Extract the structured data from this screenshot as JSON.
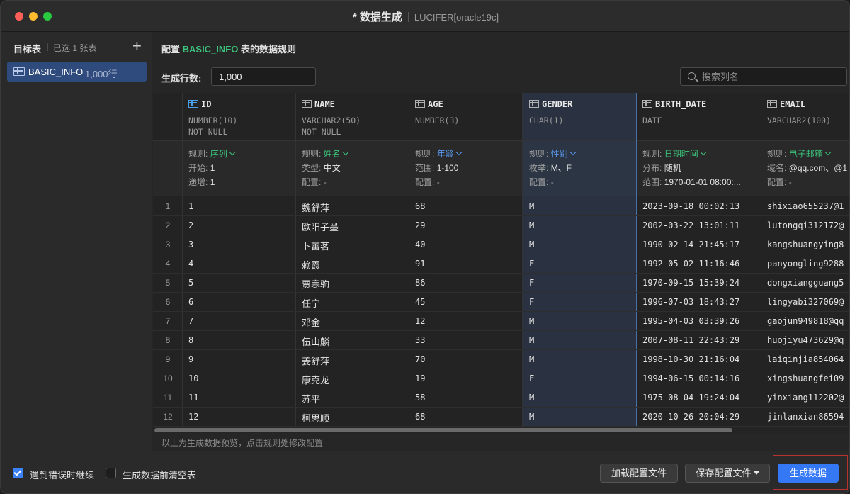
{
  "window": {
    "title": "* 数据生成",
    "connection": "LUCIFER[oracle19c]"
  },
  "sidebar": {
    "title": "目标表",
    "selected_count": "已选 1 张表",
    "add_label": "+",
    "items": [
      {
        "name": "BASIC_INFO",
        "rows": "1,000行"
      }
    ]
  },
  "config": {
    "prefix": "配置 ",
    "table_name": "BASIC_INFO",
    "suffix": " 表的数据规则",
    "rows_label": "生成行数:",
    "rows_value": "1,000",
    "search_placeholder": "搜索列名"
  },
  "columns": [
    {
      "name": "ID",
      "type": "NUMBER(10)",
      "null": "NOT NULL",
      "key": true,
      "rule_label": "规则:",
      "rule": "序列",
      "rule_color": "green",
      "l2_label": "开始:",
      "l2": "1",
      "l3_label": "递增:",
      "l3": "1"
    },
    {
      "name": "NAME",
      "type": "VARCHAR2(50)",
      "null": "NOT NULL",
      "key": false,
      "rule_label": "规则:",
      "rule": "姓名",
      "rule_color": "green",
      "l2_label": "类型:",
      "l2": "中文",
      "l3_label": "配置:",
      "l3": "-"
    },
    {
      "name": "AGE",
      "type": "NUMBER(3)",
      "null": "",
      "key": false,
      "rule_label": "规则:",
      "rule": "年龄",
      "rule_color": "blue",
      "l2_label": "范围:",
      "l2": "1-100",
      "l3_label": "配置:",
      "l3": "-"
    },
    {
      "name": "GENDER",
      "type": "CHAR(1)",
      "null": "",
      "key": false,
      "rule_label": "规则:",
      "rule": "性别",
      "rule_color": "blue",
      "l2_label": "枚举:",
      "l2": "M、F",
      "l3_label": "配置:",
      "l3": "-"
    },
    {
      "name": "BIRTH_DATE",
      "type": "DATE",
      "null": "",
      "key": false,
      "rule_label": "规则:",
      "rule": "日期时间",
      "rule_color": "green",
      "l2_label": "分布:",
      "l2": "随机",
      "l3_label": "范围:",
      "l3": "1970-01-01 08:00:..."
    },
    {
      "name": "EMAIL",
      "type": "VARCHAR2(100)",
      "null": "",
      "key": false,
      "rule_label": "规则:",
      "rule": "电子邮箱",
      "rule_color": "green",
      "l2_label": "域名:",
      "l2": "@qq.com、@1",
      "l3_label": "配置:",
      "l3": "-"
    }
  ],
  "rows": [
    {
      "n": "1",
      "id": "1",
      "name": "魏舒萍",
      "age": "68",
      "gender": "M",
      "birth": "2023-09-18 00:02:13",
      "email": "shixiao655237@1"
    },
    {
      "n": "2",
      "id": "2",
      "name": "欧阳子墨",
      "age": "29",
      "gender": "M",
      "birth": "2002-03-22 13:01:11",
      "email": "lutongqi312172@"
    },
    {
      "n": "3",
      "id": "3",
      "name": "卜蕾茗",
      "age": "40",
      "gender": "M",
      "birth": "1990-02-14 21:45:17",
      "email": "kangshuangying8"
    },
    {
      "n": "4",
      "id": "4",
      "name": "赖霞",
      "age": "91",
      "gender": "F",
      "birth": "1992-05-02 11:16:46",
      "email": "panyongling9288"
    },
    {
      "n": "5",
      "id": "5",
      "name": "贾寒驹",
      "age": "86",
      "gender": "F",
      "birth": "1970-09-15 15:39:24",
      "email": "dongxiangguang5"
    },
    {
      "n": "6",
      "id": "6",
      "name": "任宁",
      "age": "45",
      "gender": "F",
      "birth": "1996-07-03 18:43:27",
      "email": "lingyabi327069@"
    },
    {
      "n": "7",
      "id": "7",
      "name": "邓金",
      "age": "12",
      "gender": "M",
      "birth": "1995-04-03 03:39:26",
      "email": "gaojun949818@qq"
    },
    {
      "n": "8",
      "id": "8",
      "name": "伍山麟",
      "age": "33",
      "gender": "M",
      "birth": "2007-08-11 22:43:29",
      "email": "huojiyu473629@q"
    },
    {
      "n": "9",
      "id": "9",
      "name": "姜舒萍",
      "age": "70",
      "gender": "M",
      "birth": "1998-10-30 21:16:04",
      "email": "laiqinjia854064"
    },
    {
      "n": "10",
      "id": "10",
      "name": "康克龙",
      "age": "19",
      "gender": "F",
      "birth": "1994-06-15 00:14:16",
      "email": "xingshuangfei09"
    },
    {
      "n": "11",
      "id": "11",
      "name": "苏平",
      "age": "58",
      "gender": "M",
      "birth": "1975-08-04 19:24:04",
      "email": "yinxiang112202@"
    },
    {
      "n": "12",
      "id": "12",
      "name": "柯思顺",
      "age": "68",
      "gender": "M",
      "birth": "2020-10-26 20:04:29",
      "email": "jinlanxian86594"
    }
  ],
  "preview_note": "以上为生成数据预览，点击规则处修改配置",
  "footer": {
    "continue_on_error": "遇到错误时继续",
    "continue_on_error_checked": true,
    "clear_before": "生成数据前清空表",
    "clear_before_checked": false,
    "load_config": "加载配置文件",
    "save_config": "保存配置文件",
    "generate": "生成数据"
  },
  "colors": {
    "accent": "#3478f6",
    "green": "#3cc47c",
    "selection": "#2f4a7c"
  }
}
